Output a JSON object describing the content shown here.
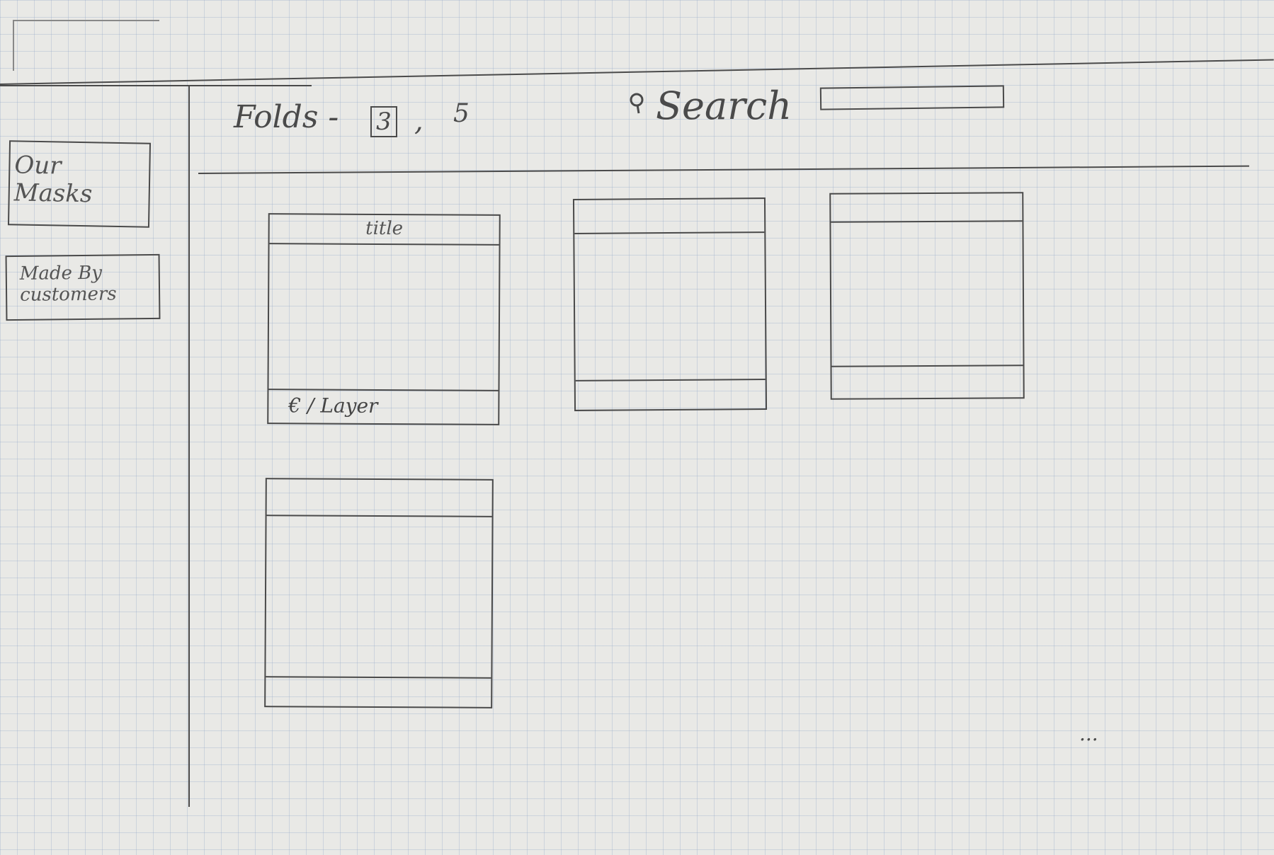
{
  "header": {
    "folds_label": "Folds -",
    "folds_current": "3",
    "folds_separator": ",",
    "folds_total": "5",
    "search_label": "Search",
    "search_value": ""
  },
  "sidebar": {
    "items": [
      {
        "label": "Our Masks"
      },
      {
        "label": "Made By customers"
      }
    ]
  },
  "cards": [
    {
      "title": "title",
      "footer": "€ / Layer"
    },
    {
      "title": "",
      "footer": ""
    },
    {
      "title": "",
      "footer": ""
    },
    {
      "title": "",
      "footer": ""
    }
  ],
  "pagination": {
    "more": "..."
  }
}
